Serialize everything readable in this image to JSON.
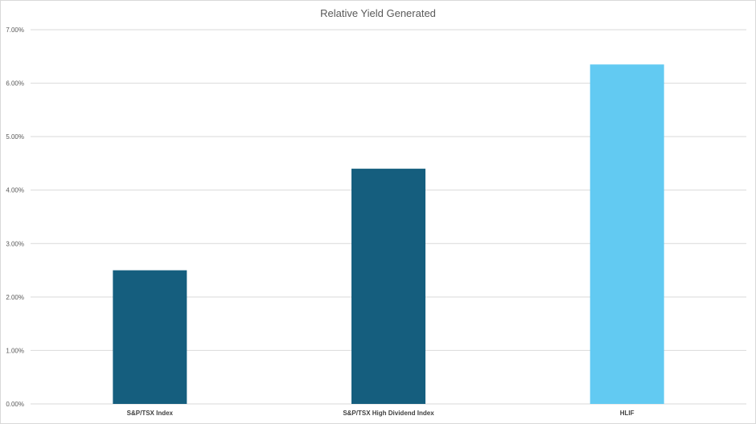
{
  "chart_data": {
    "type": "bar",
    "title": "Relative Yield Generated",
    "xlabel": "",
    "ylabel": "",
    "categories": [
      "S&P/TSX Index",
      "S&P/TSX High Dividend Index",
      "HLIF"
    ],
    "values": [
      2.5,
      4.4,
      6.35
    ],
    "value_format": "percent",
    "ylim": [
      0,
      7
    ],
    "yticks": [
      "0.00%",
      "1.00%",
      "2.00%",
      "3.00%",
      "4.00%",
      "5.00%",
      "6.00%",
      "7.00%"
    ],
    "bar_colors": [
      "#155e7e",
      "#155e7e",
      "#62caf2"
    ],
    "grid": true,
    "legend": "none"
  },
  "colors": {
    "gridline": "#d9d9d9",
    "axis_text": "#595959"
  }
}
